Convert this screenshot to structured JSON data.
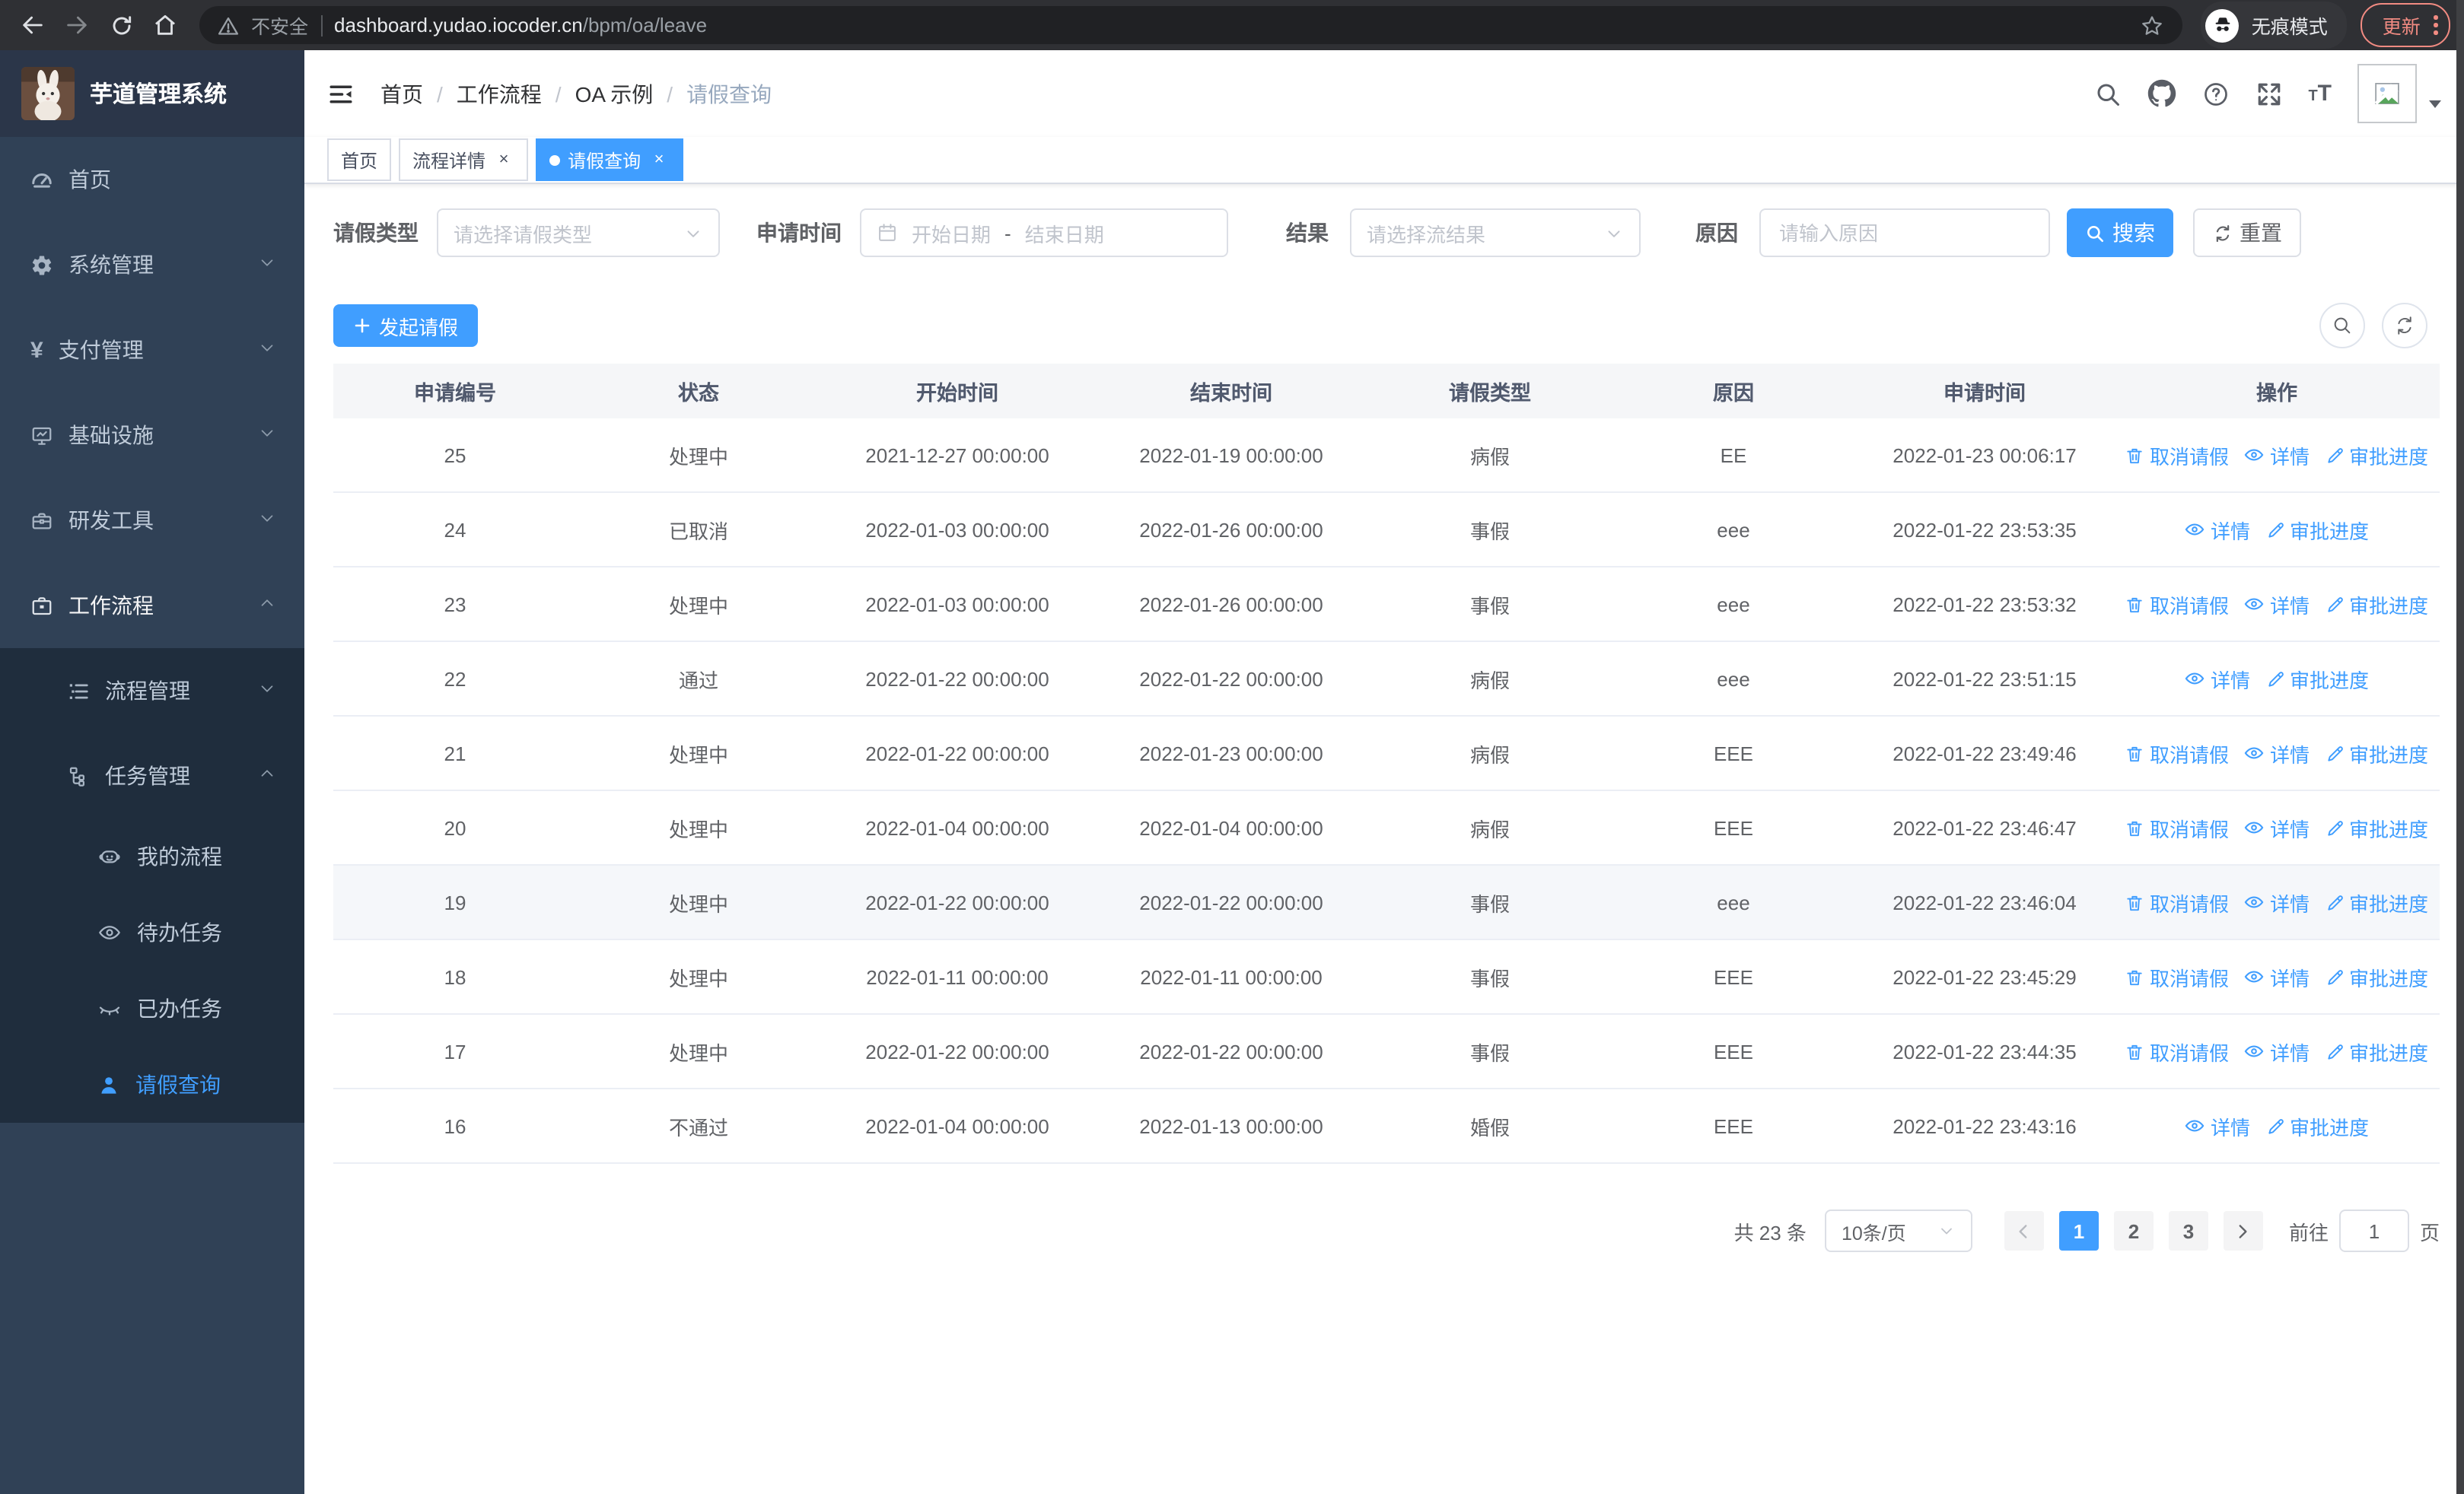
{
  "colors": {
    "primary": "#409eff",
    "sidebar_bg": "#304156",
    "submenu_bg": "#1f2d3d",
    "tag_active": "#409eff",
    "update_accent": "#f28b82"
  },
  "browser": {
    "security_chip": "不安全",
    "url_domain": "dashboard.yudao.iocoder.cn",
    "url_path": "/bpm/oa/leave",
    "incognito_label": "无痕模式",
    "update_label": "更新"
  },
  "sidebar": {
    "app_title": "芋道管理系统",
    "items": [
      {
        "key": "home",
        "label": "首页",
        "icon": "dashboard-icon"
      },
      {
        "key": "system",
        "label": "系统管理",
        "icon": "gear-icon",
        "expandable": true,
        "expanded": false
      },
      {
        "key": "payment",
        "label": "支付管理",
        "icon": "yen-icon",
        "expandable": true,
        "expanded": false
      },
      {
        "key": "infra",
        "label": "基础设施",
        "icon": "infra-icon",
        "expandable": true,
        "expanded": false
      },
      {
        "key": "devtools",
        "label": "研发工具",
        "icon": "tools-icon",
        "expandable": true,
        "expanded": false
      },
      {
        "key": "workflow",
        "label": "工作流程",
        "icon": "workflow-icon",
        "expandable": true,
        "expanded": true,
        "active_trail": true,
        "children": [
          {
            "key": "process-mgmt",
            "label": "流程管理",
            "icon": "process-list-icon",
            "expandable": true,
            "expanded": false
          },
          {
            "key": "task-mgmt",
            "label": "任务管理",
            "icon": "task-tree-icon",
            "expandable": true,
            "expanded": true,
            "children": [
              {
                "key": "my-process",
                "label": "我的流程",
                "icon": "my-process-icon"
              },
              {
                "key": "todo-tasks",
                "label": "待办任务",
                "icon": "todo-eye-icon"
              },
              {
                "key": "done-tasks",
                "label": "已办任务",
                "icon": "done-eye-icon"
              },
              {
                "key": "leave-query",
                "label": "请假查询",
                "icon": "leave-user-icon",
                "active": true
              }
            ]
          }
        ]
      }
    ]
  },
  "header": {
    "breadcrumb": [
      "首页",
      "工作流程",
      "OA 示例",
      "请假查询"
    ]
  },
  "tags": [
    {
      "label": "首页",
      "closable": false,
      "active": false
    },
    {
      "label": "流程详情",
      "closable": true,
      "active": false
    },
    {
      "label": "请假查询",
      "closable": true,
      "active": true
    }
  ],
  "filters": {
    "leave_type_label": "请假类型",
    "leave_type_placeholder": "请选择请假类型",
    "apply_time_label": "申请时间",
    "start_date_placeholder": "开始日期",
    "range_separator": "-",
    "end_date_placeholder": "结束日期",
    "result_label": "结果",
    "result_placeholder": "请选择流结果",
    "reason_label": "原因",
    "reason_placeholder": "请输入原因",
    "search_button": "搜索",
    "reset_button": "重置"
  },
  "toolbar": {
    "create_button": "发起请假"
  },
  "table": {
    "columns": [
      "申请编号",
      "状态",
      "开始时间",
      "结束时间",
      "请假类型",
      "原因",
      "申请时间",
      "操作"
    ],
    "action_labels": {
      "cancel": "取消请假",
      "detail": "详情",
      "progress": "审批进度"
    },
    "rows": [
      {
        "id": "25",
        "status": "处理中",
        "start": "2021-12-27 00:00:00",
        "end": "2022-01-19 00:00:00",
        "type": "病假",
        "reason": "EE",
        "apply_time": "2022-01-23 00:06:17",
        "can_cancel": true,
        "highlight": false
      },
      {
        "id": "24",
        "status": "已取消",
        "start": "2022-01-03 00:00:00",
        "end": "2022-01-26 00:00:00",
        "type": "事假",
        "reason": "eee",
        "apply_time": "2022-01-22 23:53:35",
        "can_cancel": false,
        "highlight": false
      },
      {
        "id": "23",
        "status": "处理中",
        "start": "2022-01-03 00:00:00",
        "end": "2022-01-26 00:00:00",
        "type": "事假",
        "reason": "eee",
        "apply_time": "2022-01-22 23:53:32",
        "can_cancel": true,
        "highlight": false
      },
      {
        "id": "22",
        "status": "通过",
        "start": "2022-01-22 00:00:00",
        "end": "2022-01-22 00:00:00",
        "type": "病假",
        "reason": "eee",
        "apply_time": "2022-01-22 23:51:15",
        "can_cancel": false,
        "highlight": false
      },
      {
        "id": "21",
        "status": "处理中",
        "start": "2022-01-22 00:00:00",
        "end": "2022-01-23 00:00:00",
        "type": "病假",
        "reason": "EEE",
        "apply_time": "2022-01-22 23:49:46",
        "can_cancel": true,
        "highlight": false
      },
      {
        "id": "20",
        "status": "处理中",
        "start": "2022-01-04 00:00:00",
        "end": "2022-01-04 00:00:00",
        "type": "病假",
        "reason": "EEE",
        "apply_time": "2022-01-22 23:46:47",
        "can_cancel": true,
        "highlight": false
      },
      {
        "id": "19",
        "status": "处理中",
        "start": "2022-01-22 00:00:00",
        "end": "2022-01-22 00:00:00",
        "type": "事假",
        "reason": "eee",
        "apply_time": "2022-01-22 23:46:04",
        "can_cancel": true,
        "highlight": true
      },
      {
        "id": "18",
        "status": "处理中",
        "start": "2022-01-11 00:00:00",
        "end": "2022-01-11 00:00:00",
        "type": "事假",
        "reason": "EEE",
        "apply_time": "2022-01-22 23:45:29",
        "can_cancel": true,
        "highlight": false
      },
      {
        "id": "17",
        "status": "处理中",
        "start": "2022-01-22 00:00:00",
        "end": "2022-01-22 00:00:00",
        "type": "事假",
        "reason": "EEE",
        "apply_time": "2022-01-22 23:44:35",
        "can_cancel": true,
        "highlight": false
      },
      {
        "id": "16",
        "status": "不通过",
        "start": "2022-01-04 00:00:00",
        "end": "2022-01-13 00:00:00",
        "type": "婚假",
        "reason": "EEE",
        "apply_time": "2022-01-22 23:43:16",
        "can_cancel": false,
        "highlight": false
      }
    ]
  },
  "pagination": {
    "total_text": "共 23 条",
    "page_size": "10条/页",
    "pages": [
      "1",
      "2",
      "3"
    ],
    "active_page": "1",
    "goto_label": "前往",
    "goto_value": "1",
    "goto_suffix": "页"
  }
}
